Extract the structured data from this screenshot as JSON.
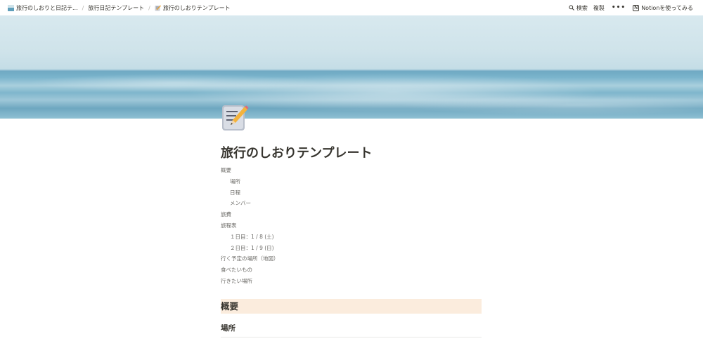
{
  "breadcrumb": {
    "items": [
      {
        "label": "旅行のしおりと日記テ...",
        "icon": "ocean-thumbnail-icon"
      },
      {
        "label": "旅行日記テンプレート",
        "icon": ""
      },
      {
        "label": "旅行のしおりテンプレート",
        "icon": "memo-icon"
      }
    ],
    "separator": "/"
  },
  "topbar": {
    "search_label": "検索",
    "duplicate_label": "複製",
    "more_label": "•••",
    "try_notion_label": "Notionを使ってみる",
    "notion_logo_letter": "N"
  },
  "page": {
    "icon": "memo-pencil-icon",
    "title": "旅行のしおりテンプレート"
  },
  "toc": [
    {
      "label": "概要",
      "level": 1
    },
    {
      "label": "場所",
      "level": 2
    },
    {
      "label": "日程",
      "level": 2
    },
    {
      "label": "メンバー",
      "level": 2
    },
    {
      "label": "旅費",
      "level": 1
    },
    {
      "label": "旅程表",
      "level": 1
    },
    {
      "label": "１日目：1 / 8 (土)",
      "level": 2
    },
    {
      "label": "２日目：1 / 9 (日)",
      "level": 2
    },
    {
      "label": "行く予定の場所（地図）",
      "level": 1
    },
    {
      "label": "食べたいもの",
      "level": 1
    },
    {
      "label": "行きたい場所",
      "level": 1
    }
  ],
  "sections": {
    "overview_heading": "概要",
    "place_heading": "場所"
  },
  "colors": {
    "heading_highlight": "#fbecdd",
    "text": "#37352f",
    "toc_text": "#6b6a66"
  }
}
